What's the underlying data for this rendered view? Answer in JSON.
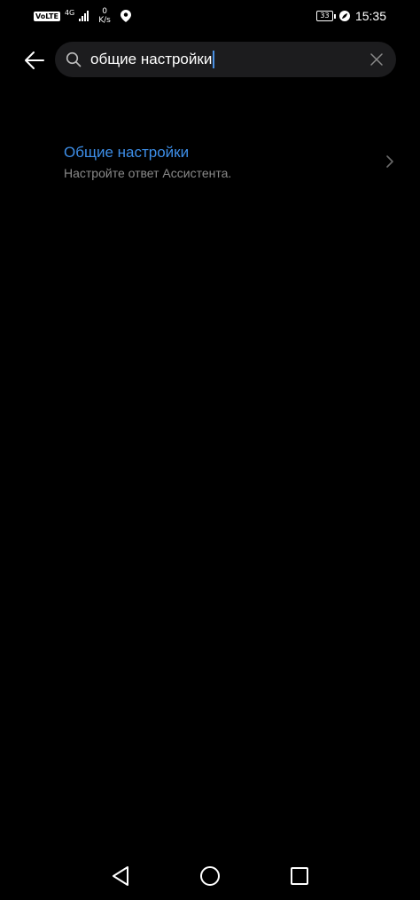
{
  "status_bar": {
    "volte": "VoLTE",
    "network_type": "4G",
    "speed_value": "0",
    "speed_unit": "K/s",
    "battery_level": "33",
    "time": "15:35"
  },
  "search": {
    "query": "общие настройки"
  },
  "results": [
    {
      "title": "Общие настройки",
      "subtitle": "Настройте ответ Ассистента."
    }
  ],
  "nav_bar": {
    "icons": [
      "back-triangle-icon",
      "home-circle-icon",
      "recents-square-icon"
    ]
  },
  "colors": {
    "background": "#000000",
    "search_box": "#1c1c1e",
    "accent": "#3d8ee8",
    "subtitle": "#8a8a8a"
  }
}
